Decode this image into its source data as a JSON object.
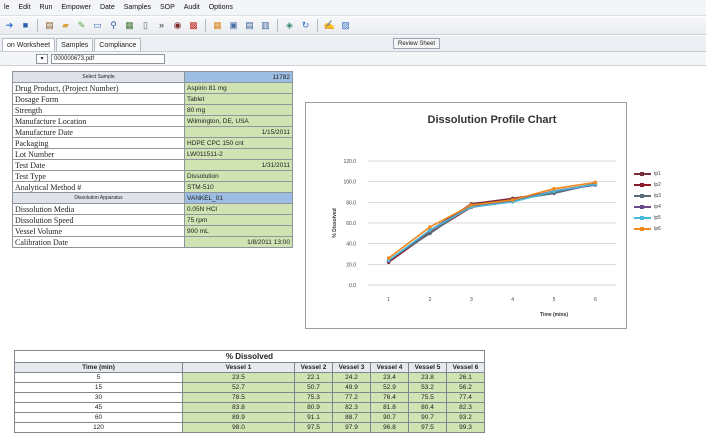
{
  "menu": [
    "le",
    "Edit",
    "Run",
    "Empower",
    "Date",
    "Samples",
    "SOP",
    "Audit",
    "Options"
  ],
  "toolbar_icons": [
    {
      "name": "arrow-icon",
      "glyph": "➜",
      "color": "#2d6bd0"
    },
    {
      "name": "save-icon",
      "glyph": "■",
      "color": "#2b5fb0"
    },
    {
      "name": "sep",
      "glyph": ""
    },
    {
      "name": "format-icon",
      "glyph": "▤",
      "color": "#8a5a2b"
    },
    {
      "name": "folder-icon",
      "glyph": "▰",
      "color": "#d9a441"
    },
    {
      "name": "edit-icon",
      "glyph": "✎",
      "color": "#5aa83a"
    },
    {
      "name": "monitor-icon",
      "glyph": "▭",
      "color": "#3a6fc4"
    },
    {
      "name": "search-icon",
      "glyph": "⚲",
      "color": "#2d5da8"
    },
    {
      "name": "grid-icon",
      "glyph": "▦",
      "color": "#4a7a3a"
    },
    {
      "name": "document-icon",
      "glyph": "▯",
      "color": "#5a6675"
    },
    {
      "name": "forward-icon",
      "glyph": "»",
      "color": "#333"
    },
    {
      "name": "binoculars-icon",
      "glyph": "◉",
      "color": "#7a2a2a"
    },
    {
      "name": "chart-icon",
      "glyph": "▩",
      "color": "#c4302b"
    },
    {
      "name": "sep",
      "glyph": ""
    },
    {
      "name": "table-icon",
      "glyph": "▦",
      "color": "#d98a1f"
    },
    {
      "name": "window-icon",
      "glyph": "▣",
      "color": "#4a6fa5"
    },
    {
      "name": "panel-icon",
      "glyph": "▤",
      "color": "#3a5f95"
    },
    {
      "name": "list-icon",
      "glyph": "▥",
      "color": "#3a5f95"
    },
    {
      "name": "sep",
      "glyph": ""
    },
    {
      "name": "network-icon",
      "glyph": "◈",
      "color": "#3a8a6a"
    },
    {
      "name": "refresh-icon",
      "glyph": "↻",
      "color": "#2d6bd0"
    },
    {
      "name": "sep",
      "glyph": ""
    },
    {
      "name": "signature-icon",
      "glyph": "✍",
      "color": "#c46a1f"
    },
    {
      "name": "image-icon",
      "glyph": "▨",
      "color": "#3a6fc4"
    }
  ],
  "tabs": [
    "on Worksheet",
    "Samples",
    "Compliance"
  ],
  "review_sheet_label": "Review Sheet",
  "file_name": "000000673.pdf",
  "info_rows": [
    {
      "label": "Select Sample",
      "value": "11782",
      "header": true,
      "blue": true,
      "right": true
    },
    {
      "label": "Drug Product, (Project Number)",
      "value": "Aspirin 81 mg"
    },
    {
      "label": "Dosage Form",
      "value": "Tablet"
    },
    {
      "label": "Strength",
      "value": "80 mg"
    },
    {
      "label": "Manufacture Location",
      "value": "Wilmington, DE, USA"
    },
    {
      "label": "Manufacture Date",
      "value": "1/15/2011",
      "right": true
    },
    {
      "label": "Packaging",
      "value": "HDPE CPC 150 cnt"
    },
    {
      "label": "Lot Number",
      "value": "LW011511-2"
    },
    {
      "label": "Test Date",
      "value": "1/31/2011",
      "right": true
    },
    {
      "label": "Test Type",
      "value": "Dissolution"
    },
    {
      "label": "Analytical Method #",
      "value": "STM-510"
    },
    {
      "label": "Dissolution Apparatus",
      "value": "VANKEL_01",
      "header": true,
      "blue": true
    },
    {
      "label": "Dissolution Media",
      "value": "0.05N HCl"
    },
    {
      "label": "Dissolution Speed",
      "value": "75 rpm"
    },
    {
      "label": "Vessel Volume",
      "value": "900 mL"
    },
    {
      "label": "Calibration Date",
      "value": "1/8/2011 13:00",
      "right": true
    }
  ],
  "chart_data": {
    "type": "line",
    "title": "Dissolution Profile Chart",
    "xlabel": "Time (mins)",
    "ylabel": "% Dissolved",
    "x": [
      1,
      2,
      3,
      4,
      5,
      6
    ],
    "ylim": [
      0,
      120
    ],
    "yticks": [
      "0.0",
      "20.0",
      "40.0",
      "60.0",
      "80.0",
      "100.0",
      "120.0"
    ],
    "grid": true,
    "legend_position": "right",
    "series": [
      {
        "name": "tp1",
        "color": "#7b2d3b",
        "marker": "diamond",
        "values": [
          23.5,
          52.7,
          78.5,
          83.8,
          89.9,
          98.0
        ]
      },
      {
        "name": "tp2",
        "color": "#8b1a2a",
        "marker": "square",
        "values": [
          22.1,
          50.7,
          75.3,
          80.9,
          91.1,
          97.5
        ]
      },
      {
        "name": "tp3",
        "color": "#5a6b7a",
        "marker": "triangle",
        "values": [
          24.2,
          49.9,
          77.2,
          82.3,
          88.7,
          97.9
        ]
      },
      {
        "name": "tp4",
        "color": "#6b4a8a",
        "marker": "x",
        "values": [
          23.4,
          52.9,
          76.4,
          81.8,
          90.7,
          96.8
        ]
      },
      {
        "name": "tp5",
        "color": "#4ab8d8",
        "marker": "star",
        "values": [
          23.8,
          53.2,
          75.5,
          80.4,
          90.7,
          97.5
        ]
      },
      {
        "name": "tp6",
        "color": "#f08a1e",
        "marker": "circle",
        "values": [
          26.1,
          56.2,
          77.4,
          82.3,
          93.2,
          99.3
        ]
      }
    ]
  },
  "dissolved_table": {
    "title": "% Dissolved",
    "columns": [
      "Time (min)",
      "Vessel 1",
      "Vessel 2",
      "Vessel 3",
      "Vessel 4",
      "Vessel 5",
      "Vessel 6"
    ],
    "rows": [
      [
        "5",
        "23.5",
        "22.1",
        "24.2",
        "23.4",
        "23.8",
        "26.1"
      ],
      [
        "15",
        "52.7",
        "50.7",
        "49.9",
        "52.9",
        "53.2",
        "56.2"
      ],
      [
        "30",
        "78.5",
        "75.3",
        "77.2",
        "76.4",
        "75.5",
        "77.4"
      ],
      [
        "45",
        "83.8",
        "80.9",
        "82.3",
        "81.8",
        "80.4",
        "82.3"
      ],
      [
        "60",
        "89.9",
        "91.1",
        "88.7",
        "90.7",
        "90.7",
        "93.2"
      ],
      [
        "120",
        "98.0",
        "97.5",
        "97.9",
        "96.8",
        "97.5",
        "99.3"
      ]
    ]
  }
}
